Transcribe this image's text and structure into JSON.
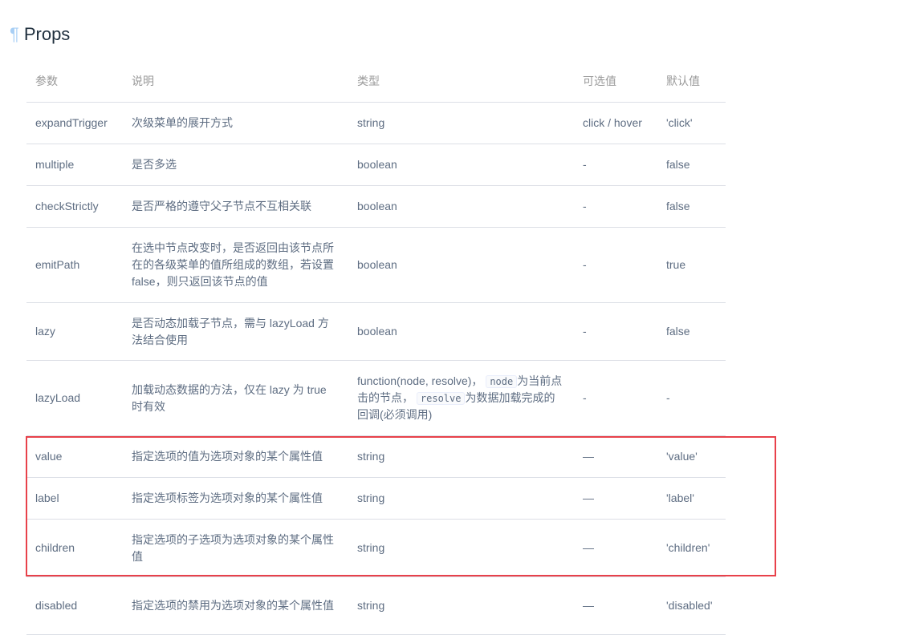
{
  "section": {
    "anchor": "¶",
    "title": "Props"
  },
  "table": {
    "headers": [
      "参数",
      "说明",
      "类型",
      "可选值",
      "默认值"
    ],
    "rows": [
      {
        "param": "expandTrigger",
        "desc": "次级菜单的展开方式",
        "type": "string",
        "options": "click / hover",
        "default": "'click'"
      },
      {
        "param": "multiple",
        "desc": "是否多选",
        "type": "boolean",
        "options": "-",
        "default": "false"
      },
      {
        "param": "checkStrictly",
        "desc": "是否严格的遵守父子节点不互相关联",
        "type": "boolean",
        "options": "-",
        "default": "false"
      },
      {
        "param": "emitPath",
        "desc": "在选中节点改变时，是否返回由该节点所在的各级菜单的值所组成的数组，若设置 false，则只返回该节点的值",
        "type": "boolean",
        "options": "-",
        "default": "true"
      },
      {
        "param": "lazy",
        "desc": "是否动态加载子节点，需与 lazyLoad 方法结合使用",
        "type": "boolean",
        "options": "-",
        "default": "false"
      },
      {
        "param": "lazyLoad",
        "desc": "加载动态数据的方法，仅在 lazy 为 true 时有效",
        "type_parts": {
          "t1": "function(node, resolve)，",
          "code1": "node",
          "t2": "为当前点击的节点，",
          "code2": "resolve",
          "t3": "为数据加载完成的回调(必须调用)"
        },
        "options": "-",
        "default": "-"
      },
      {
        "param": "value",
        "desc": "指定选项的值为选项对象的某个属性值",
        "type": "string",
        "options": "—",
        "default": "'value'"
      },
      {
        "param": "label",
        "desc": "指定选项标签为选项对象的某个属性值",
        "type": "string",
        "options": "—",
        "default": "'label'"
      },
      {
        "param": "children",
        "desc": "指定选项的子选项为选项对象的某个属性值",
        "type": "string",
        "options": "—",
        "default": "'children'"
      },
      {
        "param": "disabled",
        "desc": "指定选项的禁用为选项对象的某个属性值",
        "type": "string",
        "options": "—",
        "default": "'disabled'"
      }
    ]
  },
  "colors": {
    "highlight_border": "#e8414a",
    "anchor": "#a8cff5"
  }
}
